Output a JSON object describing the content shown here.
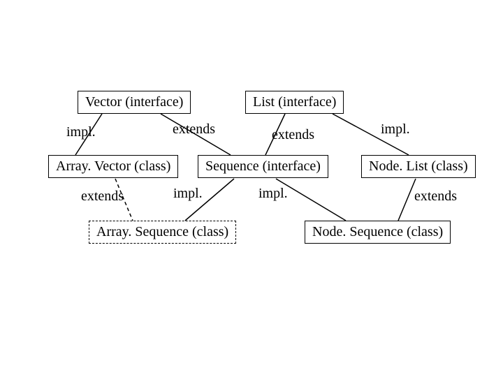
{
  "nodes": {
    "vector_interface": "Vector (interface)",
    "list_interface": "List (interface)",
    "array_vector_class": "Array. Vector (class)",
    "sequence_interface": "Sequence (interface)",
    "node_list_class": "Node. List (class)",
    "array_sequence_class": "Array. Sequence (class)",
    "node_sequence_class": "Node. Sequence (class)"
  },
  "labels": {
    "impl_tl": "impl.",
    "extends_tl": "extends",
    "extends_tr": "extends",
    "impl_tr": "impl.",
    "extends_bl": "extends",
    "impl_bl": "impl.",
    "impl_br": "impl.",
    "extends_br": "extends"
  }
}
